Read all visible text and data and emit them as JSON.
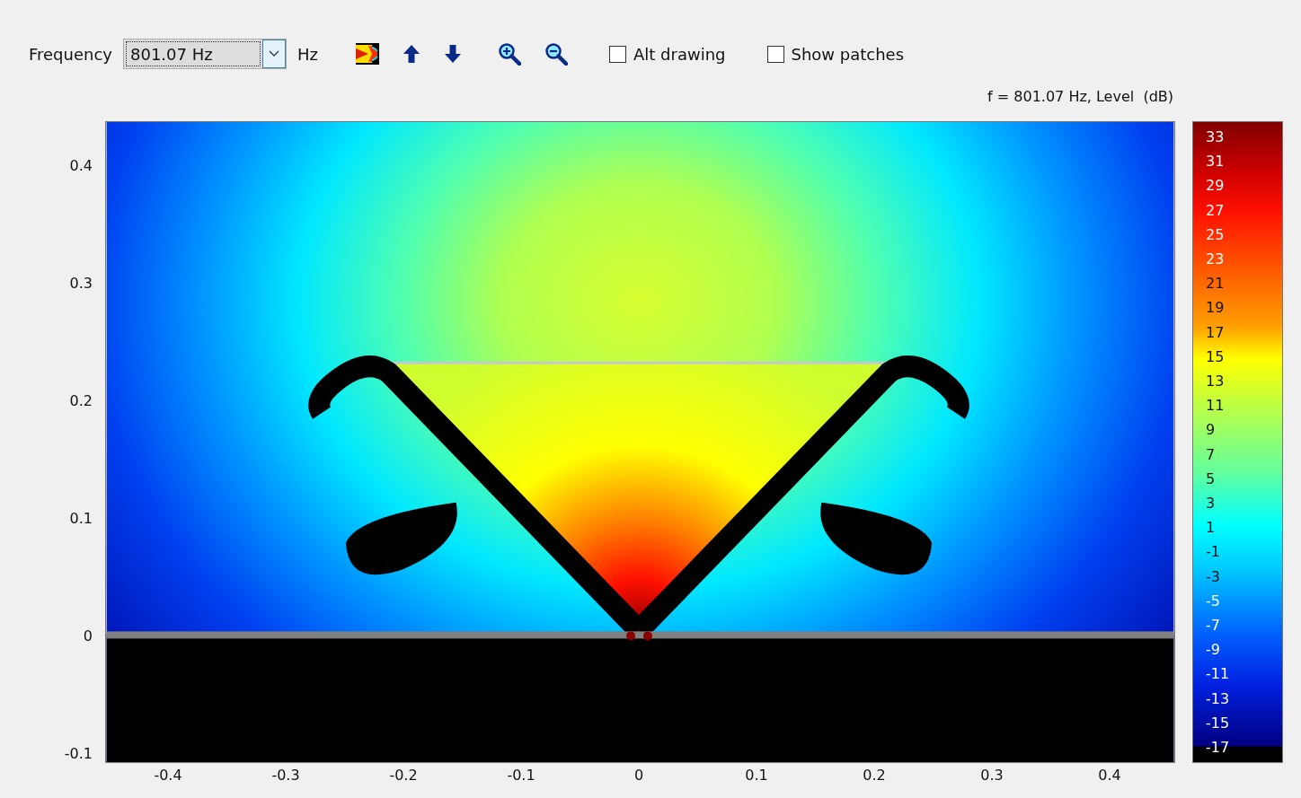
{
  "toolbar": {
    "frequency_label": "Frequency",
    "frequency_value": "801.07 Hz",
    "unit_label": "Hz",
    "checkboxes": [
      {
        "label": "Alt drawing",
        "checked": false
      },
      {
        "label": "Show patches",
        "checked": false
      }
    ]
  },
  "plot": {
    "title": "f = 801.07 Hz, Level  (dB)",
    "yticks": [
      "0.4",
      "0.3",
      "0.2",
      "0.1",
      "0",
      "-0.1"
    ],
    "xticks": [
      "-0.4",
      "-0.3",
      "-0.2",
      "-0.1",
      "0",
      "0.1",
      "0.2",
      "0.3",
      "0.4"
    ]
  },
  "colorbar": {
    "labels": [
      "33",
      "31",
      "29",
      "27",
      "25",
      "23",
      "21",
      "19",
      "17",
      "15",
      "13",
      "11",
      "9",
      "7",
      "5",
      "3",
      "1",
      "-1",
      "-3",
      "-5",
      "-7",
      "-9",
      "-11",
      "-13",
      "-15",
      "-17"
    ]
  }
}
